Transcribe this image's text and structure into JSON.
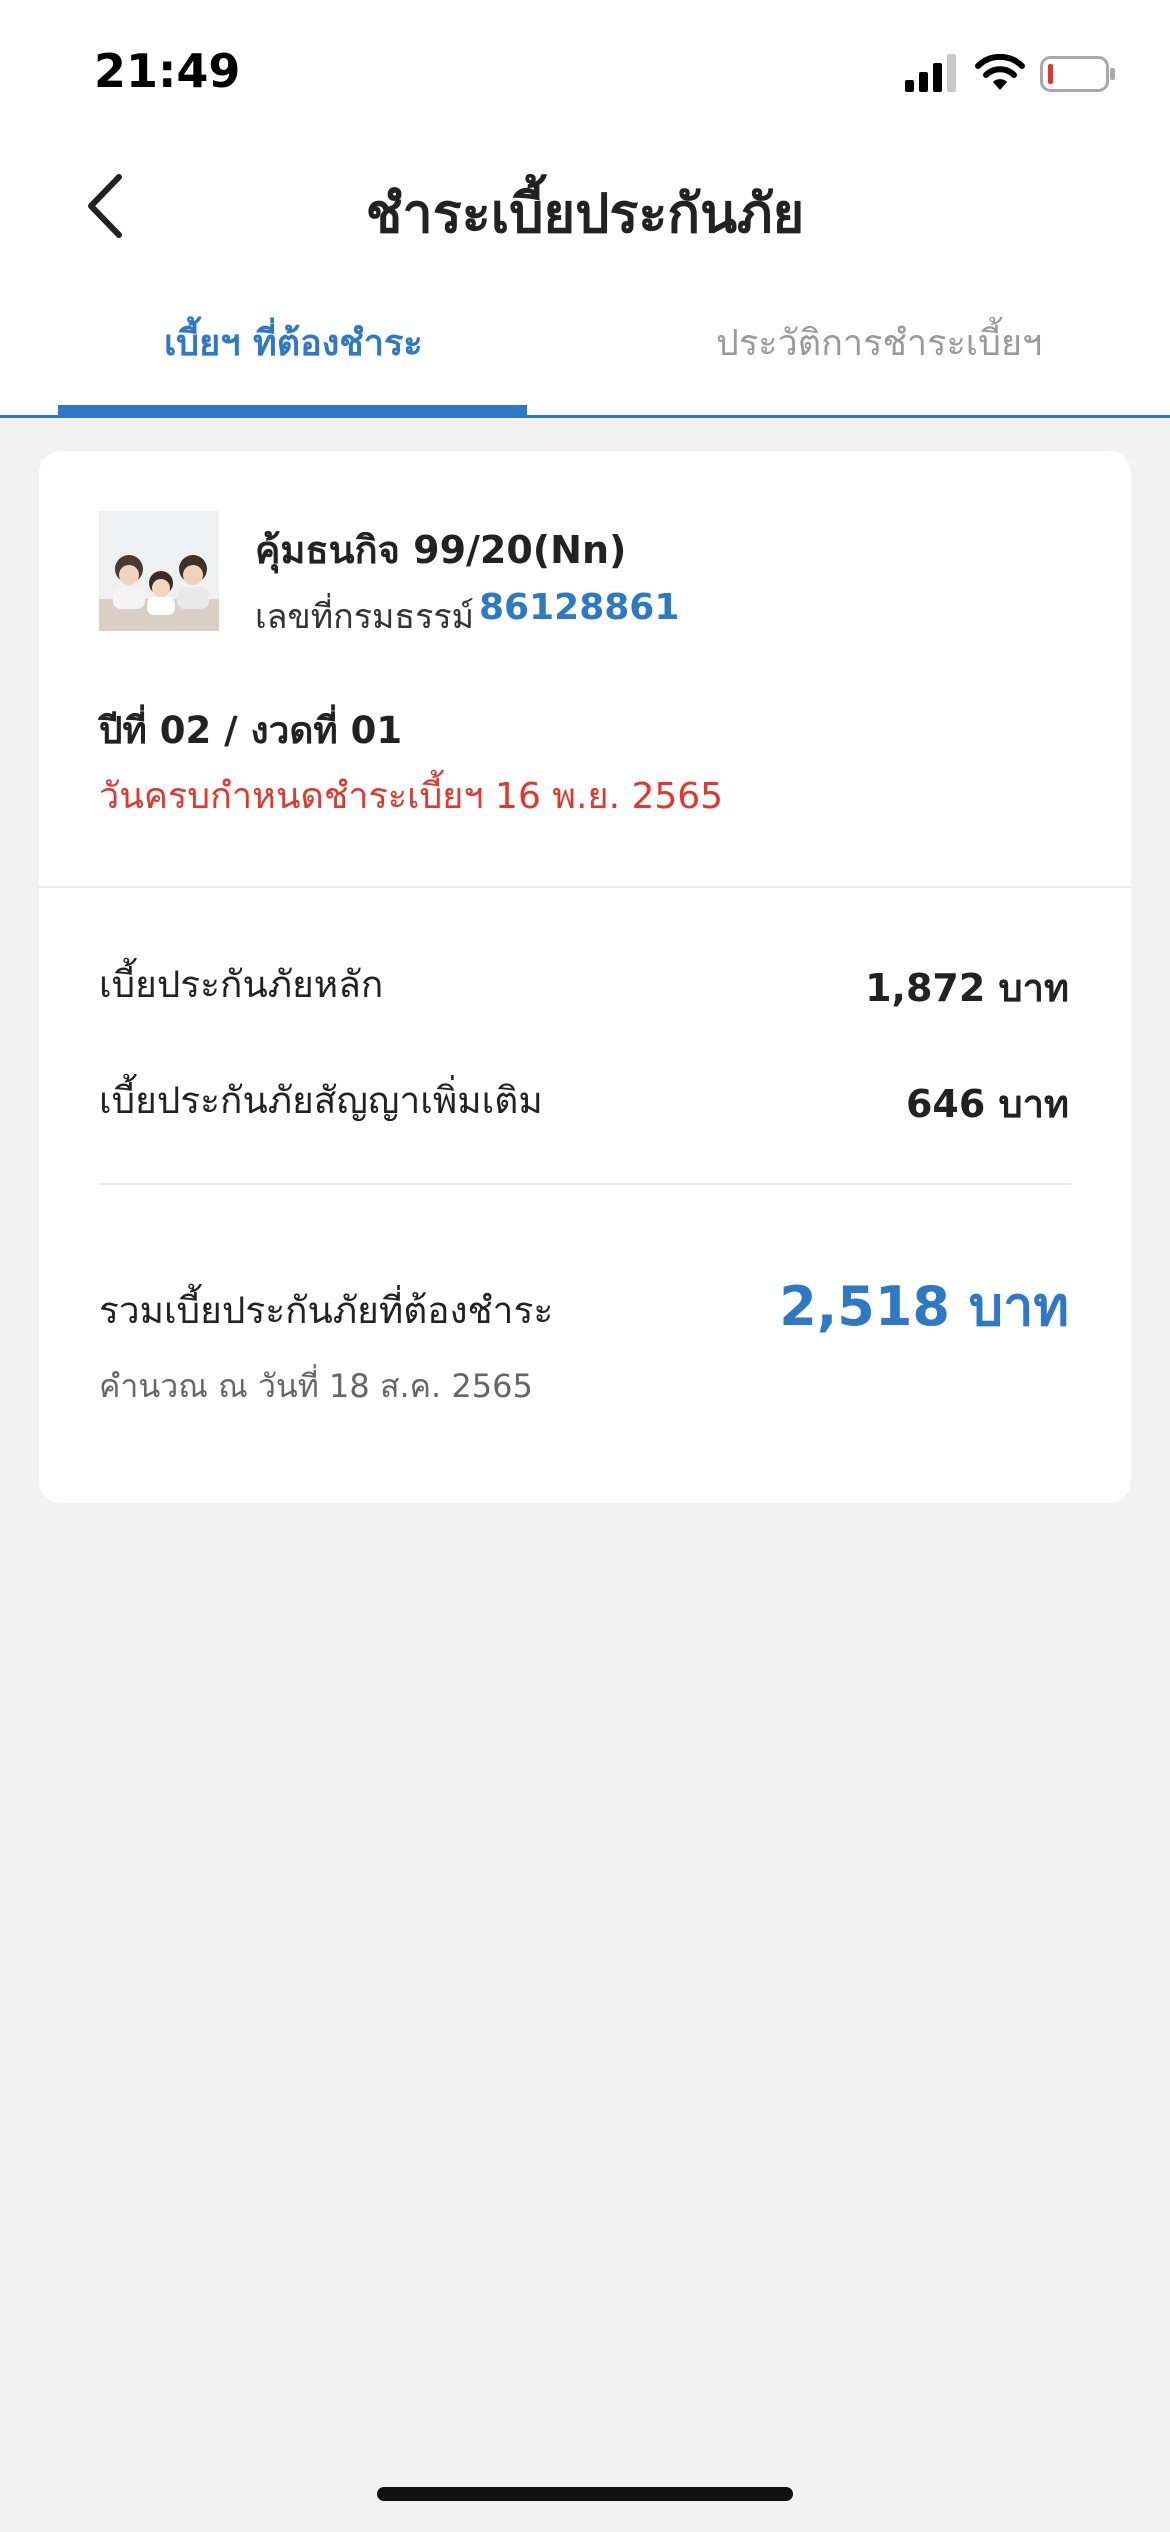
{
  "status_bar": {
    "time": "21:49",
    "icons": [
      "signal-icon",
      "wifi-icon",
      "battery-icon"
    ],
    "battery_color": "#e0382f"
  },
  "header": {
    "title": "ชำระเบี้ยประกันภัย",
    "back_icon": "chevron-left-icon"
  },
  "tabs": [
    {
      "label": "เบี้ยฯ ที่ต้องชำระ",
      "active": true
    },
    {
      "label": "ประวัติการชำระเบี้ยฯ",
      "active": false
    }
  ],
  "policy": {
    "name": "คุ้มธนกิจ 99/20(Nn)",
    "number_label": "เลขที่กรมธรรม์",
    "number": "86128861",
    "period": "ปีที่ 02 / งวดที่ 01",
    "due_date": "วันครบกำหนดชำระเบี้ยฯ 16 พ.ย. 2565"
  },
  "premiums": [
    {
      "label": "เบี้ยประกันภัยหลัก",
      "value": "1,872 บาท"
    },
    {
      "label": "เบี้ยประกันภัยสัญญาเพิ่มเติม",
      "value": "646 บาท"
    }
  ],
  "total": {
    "label": "รวมเบี้ยประกันภัยที่ต้องชำระ",
    "value": "2,518 บาท",
    "note": "คำนวณ ณ วันที่ 18 ส.ค. 2565"
  },
  "colors": {
    "accent": "#2f78c4",
    "alert": "#e0382f",
    "background": "#f2f2f2"
  }
}
